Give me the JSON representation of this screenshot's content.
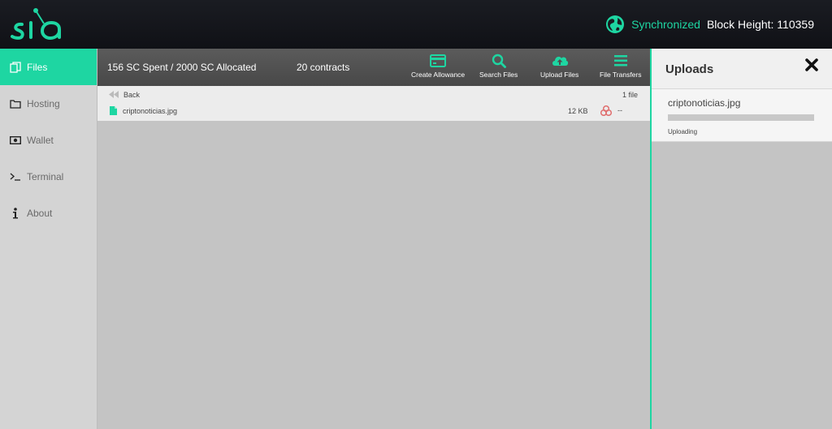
{
  "header": {
    "sync_status": "Synchronized",
    "block_height": "Block Height: 110359"
  },
  "sidebar": {
    "items": [
      {
        "label": "Files",
        "icon": "files-icon"
      },
      {
        "label": "Hosting",
        "icon": "folder-icon"
      },
      {
        "label": "Wallet",
        "icon": "wallet-icon"
      },
      {
        "label": "Terminal",
        "icon": "terminal-icon"
      },
      {
        "label": "About",
        "icon": "info-icon"
      }
    ],
    "active": "Files"
  },
  "toolbar": {
    "spent": "156 SC Spent / 2000 SC Allocated",
    "contracts": "20 contracts",
    "buttons": {
      "create_allowance": "Create Allowance",
      "search_files": "Search Files",
      "upload_files": "Upload Files",
      "file_transfers": "File Transfers"
    }
  },
  "filelist": {
    "back_label": "Back",
    "count": "1 file",
    "files": [
      {
        "name": "criptonoticias.jpg",
        "size": "12 KB",
        "status": "--"
      }
    ]
  },
  "uploads": {
    "title": "Uploads",
    "items": [
      {
        "name": "criptonoticias.jpg",
        "status": "Uploading",
        "progress": 0
      }
    ]
  },
  "colors": {
    "accent": "#1ed6a2",
    "header_bg": "#15161b",
    "redundancy_red": "#e07070"
  }
}
